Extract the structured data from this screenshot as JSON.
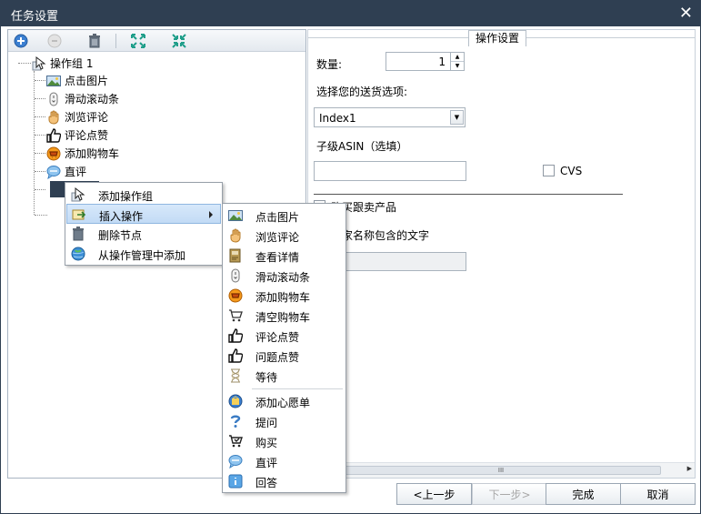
{
  "window": {
    "title": "任务设置",
    "close_glyph": "✕"
  },
  "tree": {
    "root": {
      "label": "操作组 1",
      "icon": "cursor-icon"
    },
    "children": [
      {
        "label": "点击图片",
        "icon": "picture-icon"
      },
      {
        "label": "滑动滚动条",
        "icon": "scroll-icon"
      },
      {
        "label": "浏览评论",
        "icon": "hand-icon"
      },
      {
        "label": "评论点赞",
        "icon": "thumbs-up-icon"
      },
      {
        "label": "添加购物车",
        "icon": "cart-add-icon"
      },
      {
        "label": "直评",
        "icon": "chat-bubble-icon"
      }
    ]
  },
  "context_menu": {
    "items": [
      {
        "label": "添加操作组",
        "icon": "cursor-icon"
      },
      {
        "label": "插入操作",
        "icon": "insert-icon",
        "has_submenu": true
      },
      {
        "label": "删除节点",
        "icon": "trash-icon"
      },
      {
        "label": "从操作管理中添加",
        "icon": "globe-icon"
      }
    ]
  },
  "submenu": {
    "items": [
      {
        "label": "点击图片",
        "icon": "picture-icon"
      },
      {
        "label": "浏览评论",
        "icon": "hand-icon"
      },
      {
        "label": "查看详情",
        "icon": "book-icon"
      },
      {
        "label": "滑动滚动条",
        "icon": "scroll-icon"
      },
      {
        "label": "添加购物车",
        "icon": "cart-add-icon"
      },
      {
        "label": "清空购物车",
        "icon": "cart-empty-icon"
      },
      {
        "label": "评论点赞",
        "icon": "thumbs-up-icon"
      },
      {
        "label": "问题点赞",
        "icon": "thumbs-up-icon"
      },
      {
        "label": "等待",
        "icon": "hourglass-icon"
      },
      {
        "label": "添加心愿单",
        "icon": "wishlist-icon"
      },
      {
        "label": "提问",
        "icon": "question-icon"
      },
      {
        "label": "购买",
        "icon": "cart-buy-icon"
      },
      {
        "label": "直评",
        "icon": "chat-bubble-icon"
      },
      {
        "label": "回答",
        "icon": "answer-icon"
      }
    ]
  },
  "settings": {
    "group_title": "操作设置",
    "quantity_label": "数量:",
    "quantity_value": "1",
    "shipping_label": "选择您的送货选项:",
    "shipping_value": "Index1",
    "asin_label": "子级ASIN（选填）",
    "asin_value": "",
    "cvs_label": "CVS",
    "buy_follow_label": "购买跟卖产品",
    "seller_name_label": "卖家名称包含的文字",
    "seller_name_value": "",
    "scroll_thumb_glyph": "III"
  },
  "footer": {
    "prev": "<上一步",
    "next": "下一步>",
    "finish": "完成",
    "cancel": "取消"
  }
}
